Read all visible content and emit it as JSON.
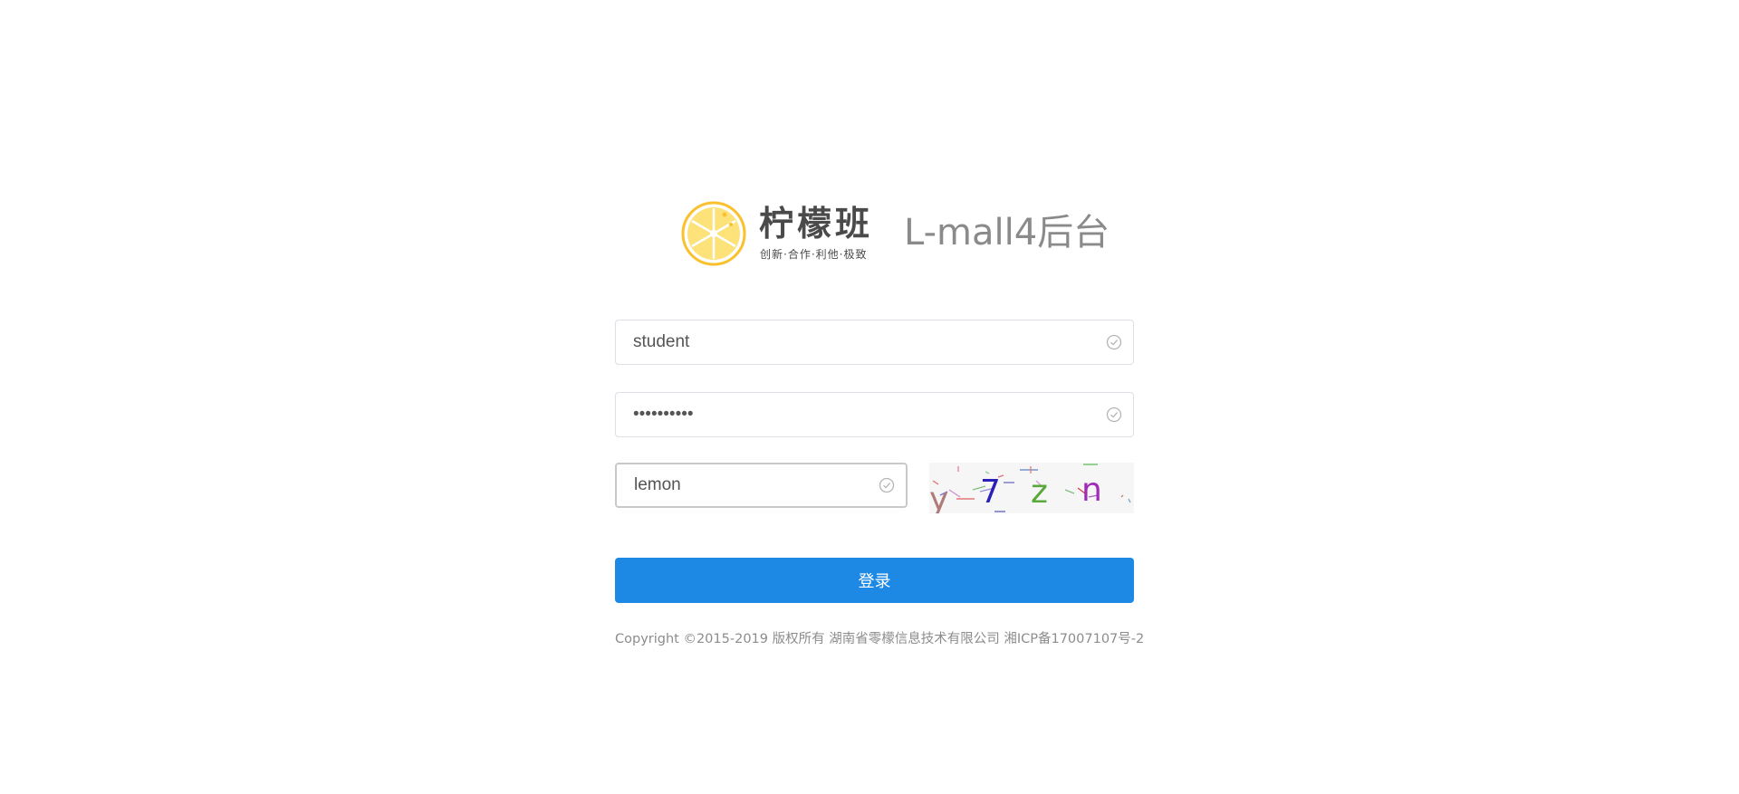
{
  "brand": {
    "logo_name": "柠檬班",
    "logo_slogan": "创新·合作·利他·极致",
    "app_title": "L-mall4后台",
    "logo_color": "#fbc02d"
  },
  "form": {
    "username": {
      "value": "student",
      "icon": "check-circle-icon"
    },
    "password": {
      "value": "••••••••••",
      "icon": "check-circle-icon"
    },
    "captcha_input": {
      "value": "lemon",
      "icon": "check-circle-icon"
    },
    "captcha_image": {
      "chars": [
        "y",
        "7",
        "z",
        "n"
      ],
      "colors": [
        "#b07a7a",
        "#2a1fb8",
        "#58a93a",
        "#a02bb8"
      ]
    },
    "login_label": "登录",
    "accent_color": "#1e88e5"
  },
  "footer": {
    "copyright": "Copyright ©2015-2019 版权所有 湖南省零檬信息技术有限公司 湘ICP备17007107号-2"
  }
}
